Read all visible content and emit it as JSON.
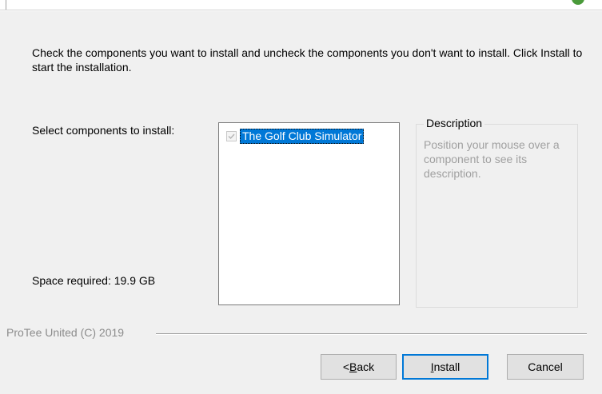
{
  "instructions": "Check the components you want to install and uncheck the components you don't want to install. Click Install to start the installation.",
  "select_label": "Select components to install:",
  "space_label": "Space required: 19.9 GB",
  "components": [
    {
      "label": "The Golf Club Simulator",
      "checked": true,
      "enabled": false,
      "selected": true
    }
  ],
  "description": {
    "title": "Description",
    "text": "Position your mouse over a component to see its description."
  },
  "brand": "ProTee United (C) 2019",
  "buttons": {
    "back_prefix": "< ",
    "back_accel": "B",
    "back_rest": "ack",
    "install_accel": "I",
    "install_rest": "nstall",
    "cancel": "Cancel"
  },
  "colors": {
    "selection": "#0078d7",
    "default_button_border": "#0078d7",
    "disabled_text": "#a0a0a0",
    "window_bg": "#f0f0f0"
  },
  "icons": {
    "checkbox": "checkmark-icon",
    "corner": "app-logo-icon"
  }
}
